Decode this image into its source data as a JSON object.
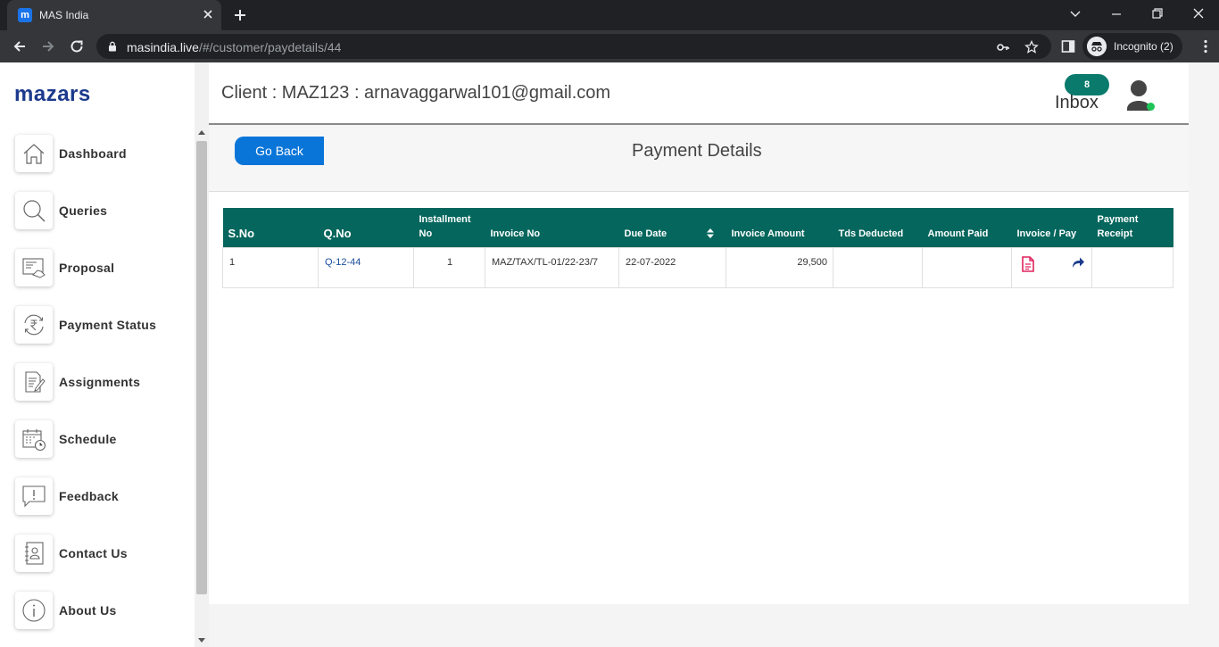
{
  "browser": {
    "tab_title": "MAS India",
    "favicon_letter": "m",
    "url_domain": "masindia.live",
    "url_path": "/#/customer/paydetails/44",
    "incognito_label": "Incognito (2)"
  },
  "sidebar": {
    "logo": "mazars",
    "items": [
      {
        "label": "Dashboard",
        "icon": "home-icon"
      },
      {
        "label": "Queries",
        "icon": "search-icon"
      },
      {
        "label": "Proposal",
        "icon": "proposal-icon"
      },
      {
        "label": "Payment Status",
        "icon": "rupee-refresh-icon"
      },
      {
        "label": "Assignments",
        "icon": "document-edit-icon"
      },
      {
        "label": "Schedule",
        "icon": "calendar-clock-icon"
      },
      {
        "label": "Feedback",
        "icon": "feedback-icon"
      },
      {
        "label": "Contact Us",
        "icon": "contact-book-icon"
      },
      {
        "label": "About Us",
        "icon": "info-icon"
      }
    ]
  },
  "header": {
    "client_text": "Client : MAZ123 : arnavaggarwal101@gmail.com",
    "inbox_count": "8",
    "inbox_label": "Inbox"
  },
  "main": {
    "go_back_label": "Go Back",
    "page_title": "Payment Details",
    "table": {
      "headers": {
        "sno": "S.No",
        "qno": "Q.No",
        "installment_line1": "Installment",
        "installment_line2": "No",
        "invoice_no": "Invoice No",
        "due_date": "Due Date",
        "invoice_amount": "Invoice Amount",
        "tds_deducted": "Tds Deducted",
        "amount_paid": "Amount Paid",
        "invoice_pay": "Invoice / Pay",
        "receipt_line1": "Payment",
        "receipt_line2": "Receipt"
      },
      "rows": [
        {
          "sno": "1",
          "qno": "Q-12-44",
          "installment": "1",
          "invoice_no": "MAZ/TAX/TL-01/22-23/7",
          "due_date": "22-07-2022",
          "invoice_amount": "29,500",
          "tds_deducted": "",
          "amount_paid": "",
          "receipt": ""
        }
      ]
    }
  },
  "colors": {
    "brand_navy": "#1b3a8c",
    "table_header": "#05665d",
    "button_blue": "#0a75d8",
    "inbox_badge": "#0a7a6c",
    "invoice_icon": "#e0245e",
    "online": "#1ec456"
  }
}
